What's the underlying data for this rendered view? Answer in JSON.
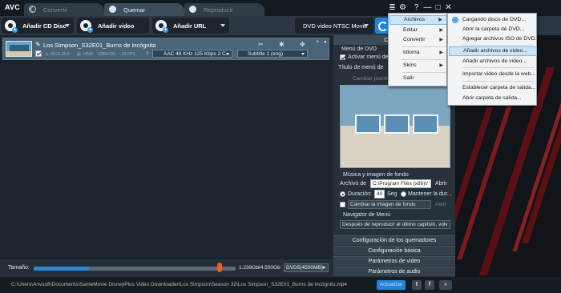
{
  "app": {
    "logo": "AVC"
  },
  "tabs": [
    {
      "label": "Convertir",
      "active": false,
      "icon": "convert-icon"
    },
    {
      "label": "Quemar",
      "active": true,
      "icon": "disc-icon"
    },
    {
      "label": "Reproducir",
      "active": false,
      "icon": "play-icon"
    }
  ],
  "window_controls": {
    "menu": "≣",
    "settings": "⚙",
    "help": "?",
    "minimize": "—",
    "maximize": "□",
    "close": "✕"
  },
  "toolbar": {
    "add_cd": "Añadir CD Disc",
    "add_video": "Añadir video",
    "add_url": "Añadir URL",
    "profile": "DVD video NTSC Movie"
  },
  "file": {
    "title": "Los Simpson_S32E01_Burns de incógnito",
    "duration": "00:21:39.6",
    "codec": "H264",
    "resolution": "1280x720",
    "fps": "23 FPS",
    "audio": "AAC 48 KHz 125 Kbps 2 C...",
    "subtitle": "Subtitle 1 (eng)"
  },
  "right_panel": {
    "header": "Configu",
    "dvd_menu_label": "Menú de DVD",
    "activate_menu": "Activar menú de",
    "menu_title_label": "Título de menú de",
    "change_theme": "Cambiar plantilla",
    "music_bg_label": "Música y imagen de fondo",
    "video_file_label": "Archivo de",
    "video_file_value": "C:\\Program Files (x86)\\/",
    "open_label": "Abrir",
    "duration_label": "Duración:",
    "duration_value": "40",
    "seconds_label": "Seg",
    "keep_duration": "Mantener la dur...",
    "change_bg": "Cambiar la imagen de fondo",
    "open_dim": "Abrir",
    "navigator_label": "Navigator de Menú",
    "navigator_value": "Después de reproducir el último capítulo, volv",
    "sections": [
      "Configuración de los quemadores",
      "Configuración básica",
      "Parámetros de video",
      "Parámetros de audio"
    ]
  },
  "size_bar": {
    "label": "Tamaño:",
    "progress": 0.275,
    "value": "1.239Gb/4.500Gb",
    "capacity": "DVD5(4500MB)"
  },
  "status": {
    "path": "C:\\Users\\Anvsoft\\Documents\\SameMovie DisneyPlus Video Downloader\\Los Simpson\\Season 32\\Los Simpson_S32E01_Burns de incógnito.mp4",
    "update": "Actualizar",
    "more": "»"
  },
  "menu_main": [
    {
      "label": "Archivos",
      "submenu": true,
      "highlighted": true
    },
    {
      "label": "Editar",
      "submenu": true
    },
    {
      "label": "Convertir",
      "submenu": true
    },
    {
      "label": "Idioma",
      "submenu": true
    },
    {
      "label": "Skins",
      "submenu": true
    },
    {
      "label": "Salir",
      "submenu": false
    }
  ],
  "menu_archivos": [
    {
      "label": "Cargando disco de DVD...",
      "icon": "disc-load-icon"
    },
    {
      "label": "Abrir la carpeta de DVD..."
    },
    {
      "label": "Agregar archivos ISO de DVD..."
    },
    {
      "label": "Añadir archivos de video...",
      "highlighted": true
    },
    {
      "label": "Añadir archivos de video..."
    },
    {
      "label": "Importar video desde la web..."
    },
    {
      "label": "Establecer carpeta de salida..."
    },
    {
      "label": "Abrir carpeta de salida..."
    }
  ],
  "colors": {
    "accent": "#1f86db",
    "slider_thumb": "#f05a24",
    "menu_highlight": "#cce4f7"
  }
}
